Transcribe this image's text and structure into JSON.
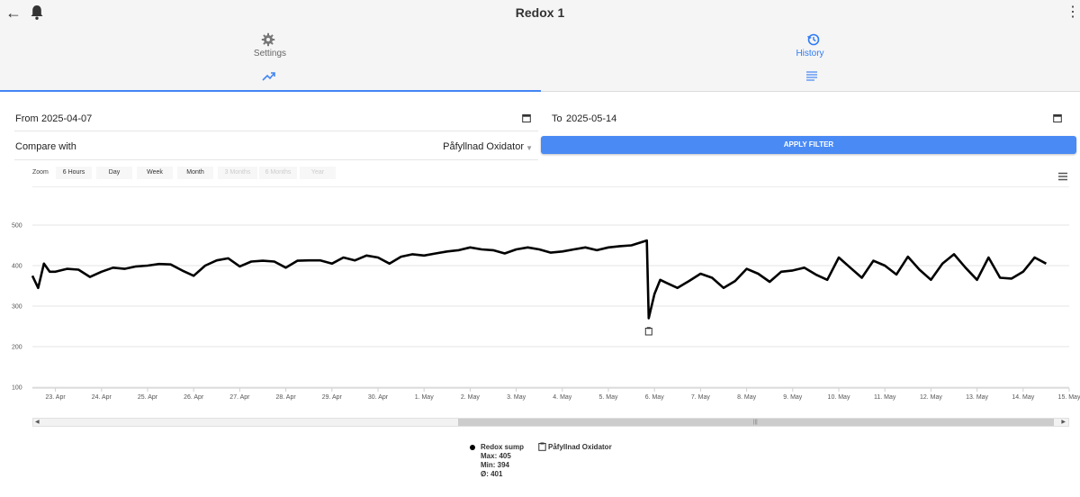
{
  "app": {
    "title": "Redox 1",
    "icons": {
      "back": "arrow-left-icon",
      "notifications": "bell-icon",
      "more": "more-vertical-icon"
    }
  },
  "tabs": [
    {
      "label": "Settings",
      "icon": "gear-icon",
      "sub_icon": "trending-up-icon",
      "active": true
    },
    {
      "label": "History",
      "icon": "history-icon",
      "sub_icon": "list-lines-icon",
      "active": false
    }
  ],
  "filter": {
    "from_label": "From",
    "from_value": "2025-04-07",
    "to_label": "To",
    "to_value": "2025-05-14",
    "compare_label": "Compare with",
    "compare_value": "Påfyllnad Oxidator",
    "apply_label": "APPLY FILTER"
  },
  "zoom": {
    "label": "Zoom",
    "buttons": [
      {
        "label": "6 Hours",
        "enabled": true
      },
      {
        "label": "Day",
        "enabled": true
      },
      {
        "label": "Week",
        "enabled": true
      },
      {
        "label": "Month",
        "enabled": true
      },
      {
        "label": "3 Months",
        "enabled": false
      },
      {
        "label": "6 Months",
        "enabled": false
      },
      {
        "label": "Year",
        "enabled": false
      }
    ]
  },
  "legend": {
    "series_name": "Redox sump",
    "max": "Max: 405",
    "min": "Min: 394",
    "avg": "Ø: 401",
    "compare_name": "Påfyllnad Oxidator"
  },
  "colors": {
    "accent": "#4285f4",
    "apply_button": "#4a8af4",
    "line": "#000000",
    "tab_active_text": "#2f7bf5"
  },
  "chart_data": {
    "type": "line",
    "ylim": [
      100,
      500
    ],
    "yticks": [
      100,
      200,
      300,
      400,
      500
    ],
    "xlim": [
      "2025-04-22T12:00",
      "2025-05-15T00:00"
    ],
    "xtick_labels": [
      "23. Apr",
      "24. Apr",
      "25. Apr",
      "26. Apr",
      "27. Apr",
      "28. Apr",
      "29. Apr",
      "30. Apr",
      "1. May",
      "2. May",
      "3. May",
      "4. May",
      "5. May",
      "6. May",
      "7. May",
      "8. May",
      "9. May",
      "10. May",
      "11. May",
      "12. May",
      "13. May",
      "14. May",
      "15. May"
    ],
    "grid": true,
    "series": [
      {
        "name": "Redox sump",
        "x": [
          "2025-04-22T12:00",
          "2025-04-22T15:00",
          "2025-04-22T18:00",
          "2025-04-22T21:00",
          "2025-04-23T00:00",
          "2025-04-23T06:00",
          "2025-04-23T12:00",
          "2025-04-23T18:00",
          "2025-04-24T00:00",
          "2025-04-24T06:00",
          "2025-04-24T12:00",
          "2025-04-24T18:00",
          "2025-04-25T00:00",
          "2025-04-25T06:00",
          "2025-04-25T12:00",
          "2025-04-25T18:00",
          "2025-04-26T00:00",
          "2025-04-26T06:00",
          "2025-04-26T12:00",
          "2025-04-26T18:00",
          "2025-04-27T00:00",
          "2025-04-27T06:00",
          "2025-04-27T12:00",
          "2025-04-27T18:00",
          "2025-04-28T00:00",
          "2025-04-28T06:00",
          "2025-04-28T12:00",
          "2025-04-28T18:00",
          "2025-04-29T00:00",
          "2025-04-29T06:00",
          "2025-04-29T12:00",
          "2025-04-29T18:00",
          "2025-04-30T00:00",
          "2025-04-30T06:00",
          "2025-04-30T12:00",
          "2025-04-30T18:00",
          "2025-05-01T00:00",
          "2025-05-01T06:00",
          "2025-05-01T12:00",
          "2025-05-01T18:00",
          "2025-05-02T00:00",
          "2025-05-02T06:00",
          "2025-05-02T12:00",
          "2025-05-02T18:00",
          "2025-05-03T00:00",
          "2025-05-03T06:00",
          "2025-05-03T12:00",
          "2025-05-03T18:00",
          "2025-05-04T00:00",
          "2025-05-04T06:00",
          "2025-05-04T12:00",
          "2025-05-04T18:00",
          "2025-05-05T00:00",
          "2025-05-05T06:00",
          "2025-05-05T12:00",
          "2025-05-05T20:00",
          "2025-05-05T21:00",
          "2025-05-05T22:00",
          "2025-05-06T00:00",
          "2025-05-06T03:00",
          "2025-05-06T06:00",
          "2025-05-06T12:00",
          "2025-05-06T18:00",
          "2025-05-07T00:00",
          "2025-05-07T06:00",
          "2025-05-07T12:00",
          "2025-05-07T18:00",
          "2025-05-08T00:00",
          "2025-05-08T06:00",
          "2025-05-08T12:00",
          "2025-05-08T18:00",
          "2025-05-09T00:00",
          "2025-05-09T06:00",
          "2025-05-09T12:00",
          "2025-05-09T18:00",
          "2025-05-10T00:00",
          "2025-05-10T06:00",
          "2025-05-10T12:00",
          "2025-05-10T18:00",
          "2025-05-11T00:00",
          "2025-05-11T06:00",
          "2025-05-11T12:00",
          "2025-05-11T18:00",
          "2025-05-12T00:00",
          "2025-05-12T06:00",
          "2025-05-12T12:00",
          "2025-05-12T18:00",
          "2025-05-13T00:00",
          "2025-05-13T06:00",
          "2025-05-13T12:00",
          "2025-05-13T18:00",
          "2025-05-14T00:00",
          "2025-05-14T06:00",
          "2025-05-14T12:00"
        ],
        "y": [
          375,
          345,
          405,
          385,
          385,
          392,
          390,
          372,
          385,
          395,
          392,
          398,
          400,
          404,
          403,
          388,
          375,
          400,
          413,
          418,
          398,
          410,
          412,
          410,
          395,
          412,
          413,
          413,
          405,
          420,
          413,
          425,
          420,
          405,
          422,
          428,
          425,
          430,
          435,
          438,
          445,
          440,
          438,
          430,
          440,
          445,
          440,
          432,
          435,
          440,
          445,
          438,
          445,
          448,
          450,
          462,
          270,
          290,
          330,
          365,
          358,
          345,
          362,
          380,
          370,
          345,
          362,
          392,
          380,
          360,
          385,
          388,
          395,
          378,
          365,
          420,
          395,
          370,
          412,
          400,
          378,
          422,
          390,
          365,
          405,
          428,
          395,
          365,
          420,
          370,
          368,
          385,
          420,
          405
        ]
      }
    ],
    "annotations": [
      {
        "series": "Påfyllnad Oxidator",
        "x": "2025-05-05T21:00"
      }
    ]
  }
}
